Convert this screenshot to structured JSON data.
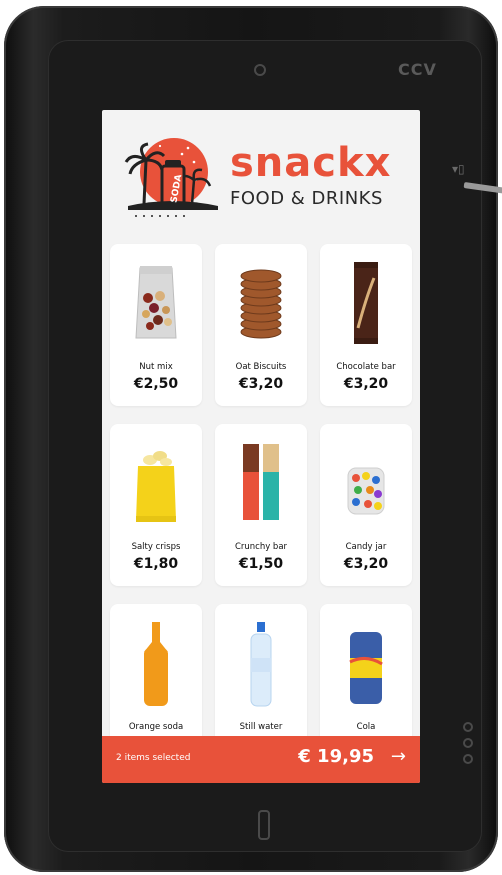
{
  "device": {
    "brand": "CCV"
  },
  "app": {
    "brand_name": "snackx",
    "brand_sub": "FOOD & DRINKS",
    "logo_badge": "SODA",
    "accent": "#e8523a"
  },
  "products": [
    {
      "name": "Nut mix",
      "price": "€2,50",
      "icon": "nut-mix-bag"
    },
    {
      "name": "Oat Biscuits",
      "price": "€3,20",
      "icon": "oat-biscuits-stack"
    },
    {
      "name": "Chocolate bar",
      "price": "€3,20",
      "icon": "chocolate-bar"
    },
    {
      "name": "Salty crisps",
      "price": "€1,80",
      "icon": "crisps-bag"
    },
    {
      "name": "Crunchy bar",
      "price": "€1,50",
      "icon": "crunchy-bars"
    },
    {
      "name": "Candy jar",
      "price": "€3,20",
      "icon": "candy-jar"
    },
    {
      "name": "Orange soda",
      "price": "",
      "icon": "orange-soda-bottle"
    },
    {
      "name": "Still water",
      "price": "",
      "icon": "water-bottle"
    },
    {
      "name": "Cola",
      "price": "",
      "icon": "cola-can"
    }
  ],
  "cart": {
    "items_selected": "2 items selected",
    "total": "€ 19,95",
    "arrow_icon": "arrow-right-icon"
  }
}
